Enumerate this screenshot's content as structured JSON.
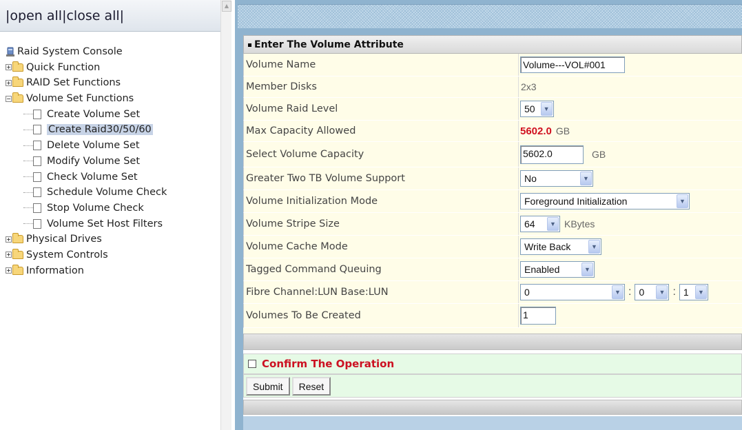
{
  "nav": {
    "open_all": "open all",
    "close_all": "close all",
    "sep": "|"
  },
  "tree": {
    "root": "Raid System Console",
    "quick": "Quick Function",
    "raid_set": "RAID Set Functions",
    "volume_set": "Volume Set Functions",
    "volume_children": [
      "Create Volume Set",
      "Create Raid30/50/60",
      "Delete Volume Set",
      "Modify Volume Set",
      "Check Volume Set",
      "Schedule Volume Check",
      "Stop Volume Check",
      "Volume Set Host Filters"
    ],
    "physical": "Physical Drives",
    "system": "System Controls",
    "information": "Information",
    "selected": "Create Raid30/50/60"
  },
  "form": {
    "title": "Enter The Volume Attribute",
    "rows": {
      "volume_name": {
        "label": "Volume Name",
        "value": "Volume---VOL#001"
      },
      "member_disks": {
        "label": "Member Disks",
        "value": "2x3"
      },
      "raid_level": {
        "label": "Volume Raid Level",
        "value": "50"
      },
      "max_capacity": {
        "label": "Max Capacity Allowed",
        "value": "5602.0",
        "unit": "GB"
      },
      "select_capacity": {
        "label": "Select Volume Capacity",
        "value": "5602.0",
        "unit": "GB"
      },
      "greater_two_tb": {
        "label": "Greater Two TB Volume Support",
        "value": "No"
      },
      "init_mode": {
        "label": "Volume Initialization Mode",
        "value": "Foreground Initialization"
      },
      "stripe_size": {
        "label": "Volume Stripe Size",
        "value": "64",
        "unit": "KBytes"
      },
      "cache_mode": {
        "label": "Volume Cache Mode",
        "value": "Write Back"
      },
      "tcq": {
        "label": "Tagged Command Queuing",
        "value": "Enabled"
      },
      "fibre_lun": {
        "label": "Fibre Channel:LUN Base:LUN",
        "channel": "0",
        "lun_base": "0",
        "lun": "1",
        "sep": ":"
      },
      "volumes_to_create": {
        "label": "Volumes To Be Created",
        "value": "1"
      }
    },
    "confirm": "Confirm The Operation",
    "confirm_checked": false,
    "submit": "Submit",
    "reset": "Reset"
  },
  "icons": {
    "expand": "plus-box-icon",
    "collapse": "minus-box-icon",
    "folder": "folder-icon",
    "doc": "document-icon",
    "dropdown": "chevron-down-icon"
  },
  "colors": {
    "row_bg": "#fffde8",
    "confirm_bg": "#e6fae6",
    "accent_red": "#d01020",
    "frame_blue": "#8fb3cf",
    "selection": "#c7d3e6"
  }
}
